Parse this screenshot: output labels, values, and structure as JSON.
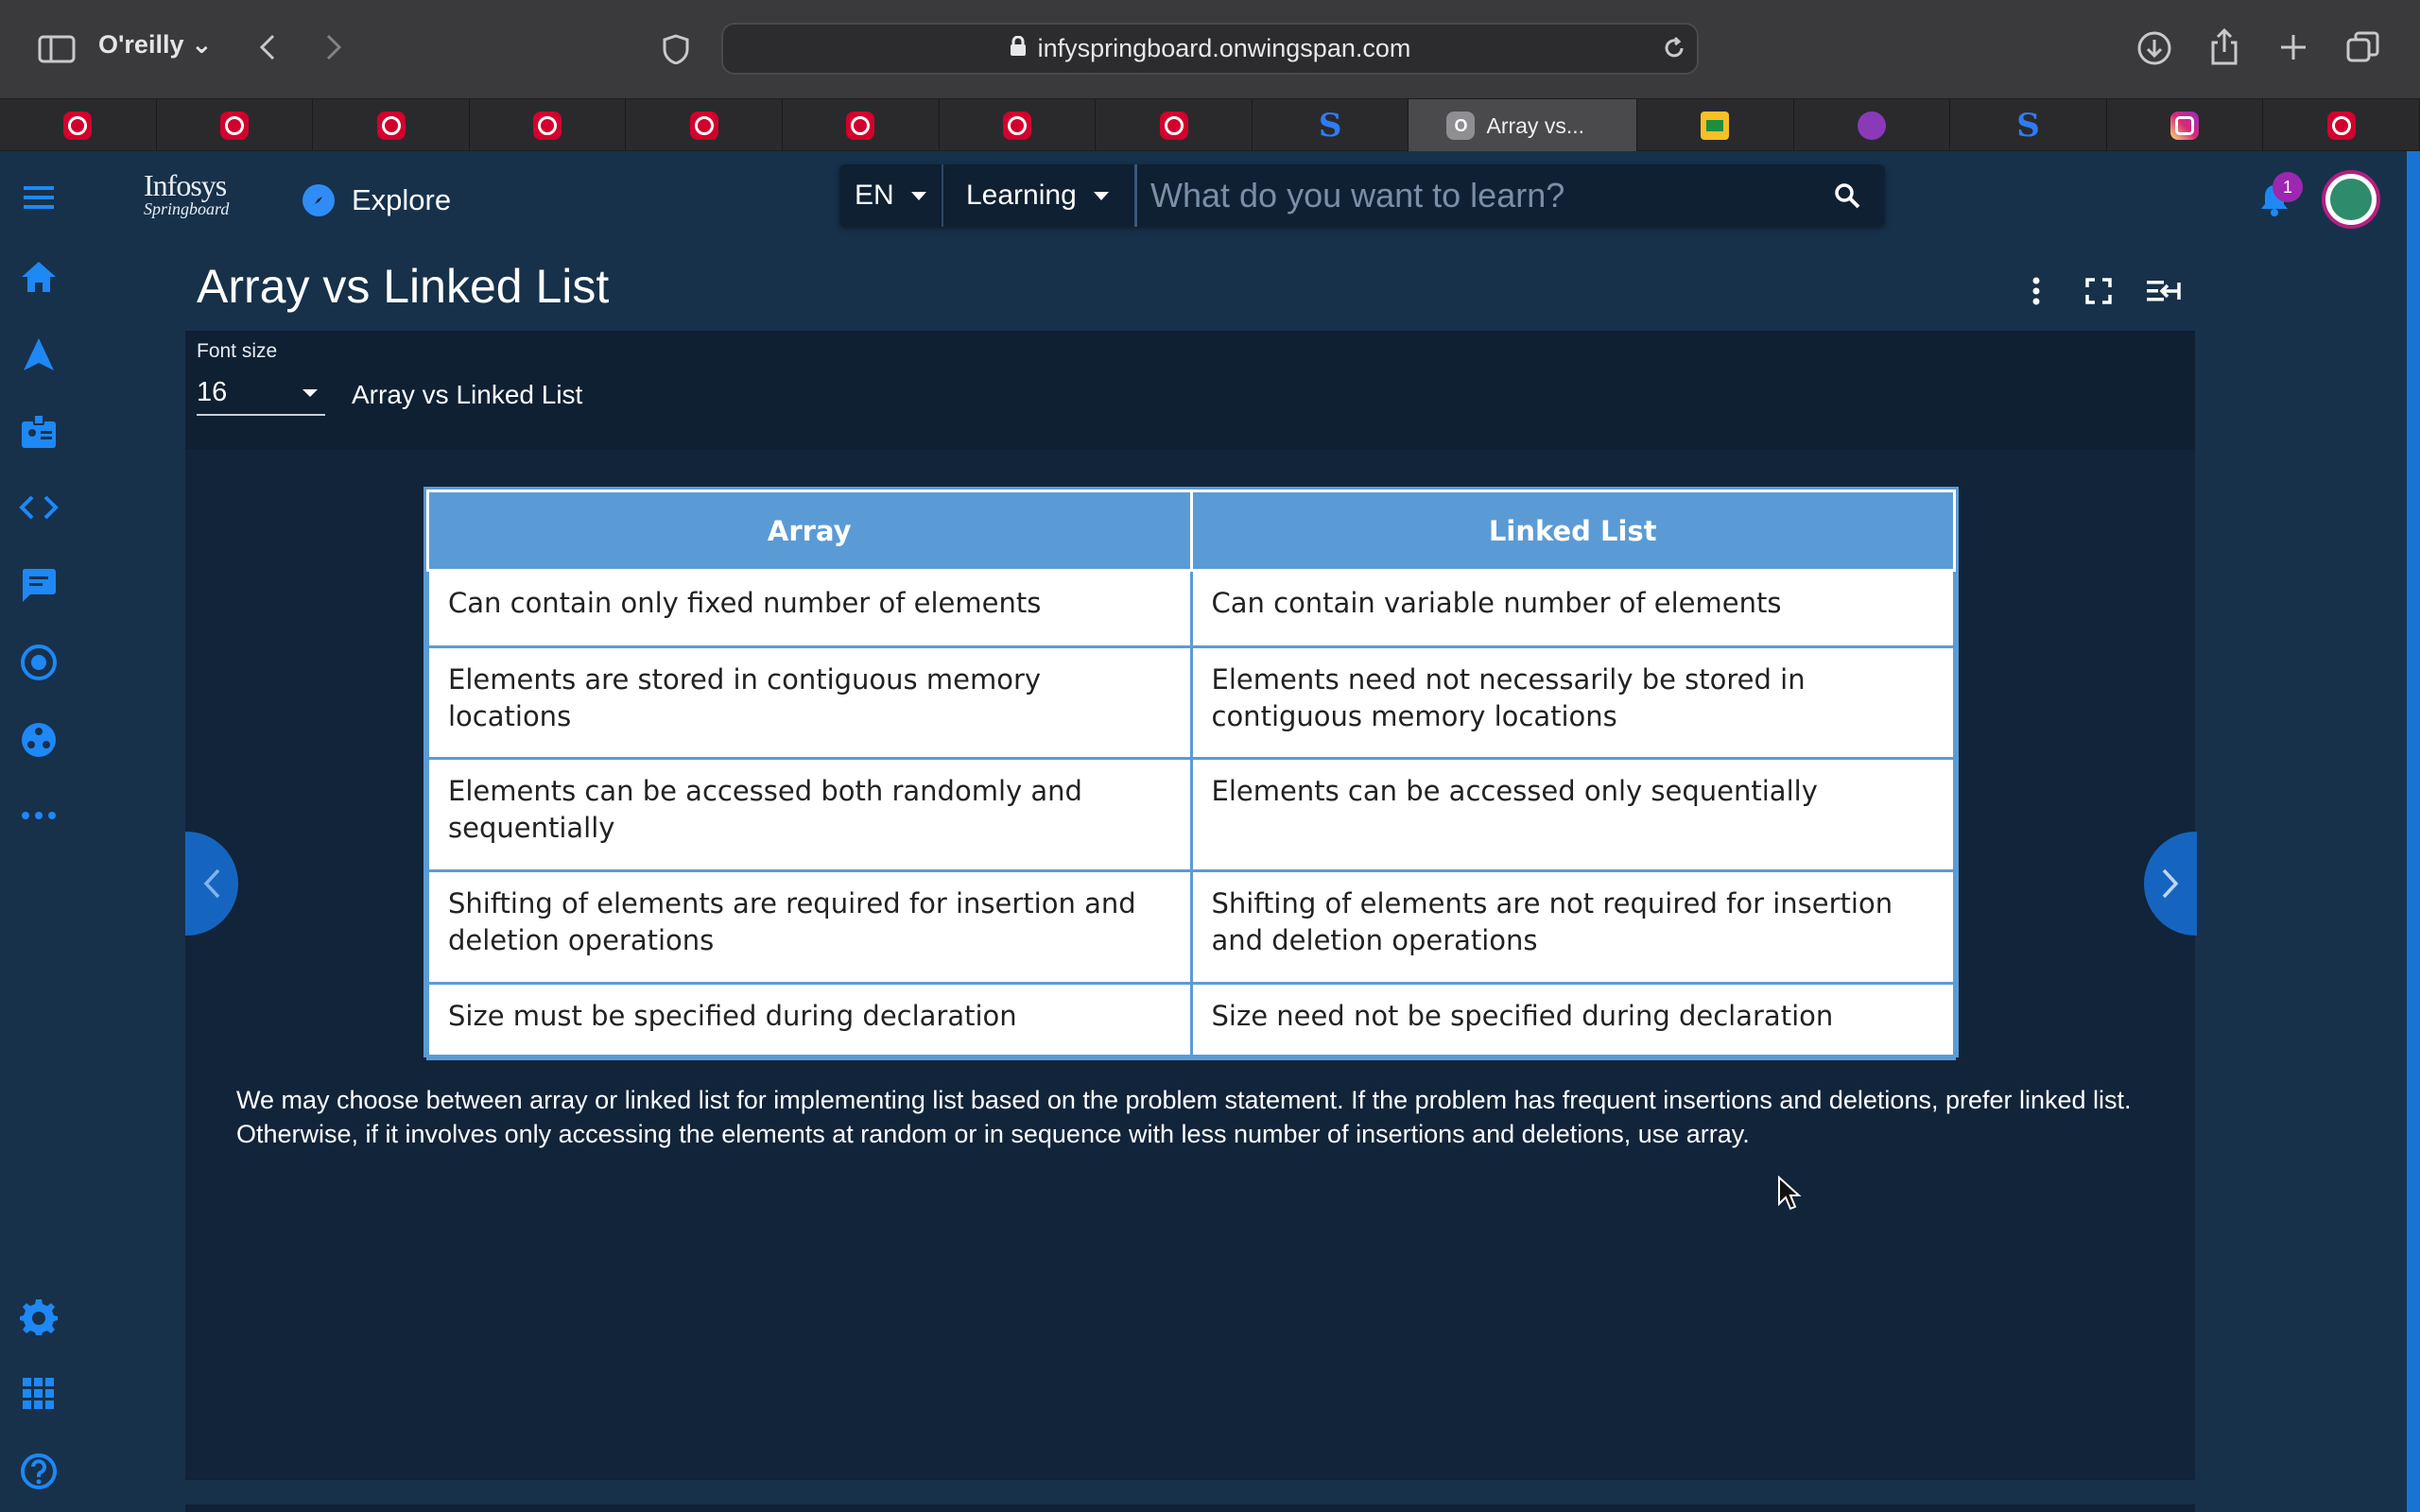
{
  "browser": {
    "profile": "O'reilly",
    "url": "infyspringboard.onwingspan.com",
    "tabs": [
      {
        "icon": "oreilly-icon"
      },
      {
        "icon": "oreilly-icon"
      },
      {
        "icon": "oreilly-icon"
      },
      {
        "icon": "oreilly-icon"
      },
      {
        "icon": "oreilly-icon"
      },
      {
        "icon": "oreilly-icon"
      },
      {
        "icon": "oreilly-icon"
      },
      {
        "icon": "oreilly-icon"
      },
      {
        "icon": "s-icon"
      },
      {
        "icon": "o-icon",
        "title": "Array vs..."
      },
      {
        "icon": "classroom-icon"
      },
      {
        "icon": "pink-icon"
      },
      {
        "icon": "s-icon"
      },
      {
        "icon": "instagram-icon"
      },
      {
        "icon": "oreilly-icon"
      }
    ]
  },
  "header": {
    "logo_line1": "Infosys",
    "logo_line2": "Springboard",
    "explore_label": "Explore",
    "language": "EN",
    "category": "Learning",
    "search_placeholder": "What do you want to learn?",
    "notification_count": "1"
  },
  "page": {
    "title": "Array vs Linked List",
    "font_size_label": "Font size",
    "font_size_value": "16",
    "doc_name": "Array vs Linked List"
  },
  "table": {
    "headers": [
      "Array",
      "Linked List"
    ],
    "rows": [
      [
        "Can contain only fixed number of elements",
        "Can contain variable number of elements"
      ],
      [
        "Elements are stored in contiguous memory locations",
        "Elements need not necessarily be stored in contiguous memory locations"
      ],
      [
        "Elements can be accessed both randomly and sequentially",
        "Elements can be accessed only sequentially"
      ],
      [
        "Shifting of elements are required for insertion and deletion operations",
        "Shifting of elements are not required for insertion and deletion operations"
      ],
      [
        "Size must be specified during declaration",
        "Size need not be specified during declaration"
      ]
    ]
  },
  "summary": "We may choose between array or linked list for implementing list based on the problem statement. If the problem has frequent insertions and deletions, prefer linked list. Otherwise, if it involves only accessing the elements at random or in sequence with less number of insertions and deletions, use array.",
  "colors": {
    "accent": "#1e88f5",
    "table_header": "#5b9bd5",
    "background": "#17314b"
  }
}
